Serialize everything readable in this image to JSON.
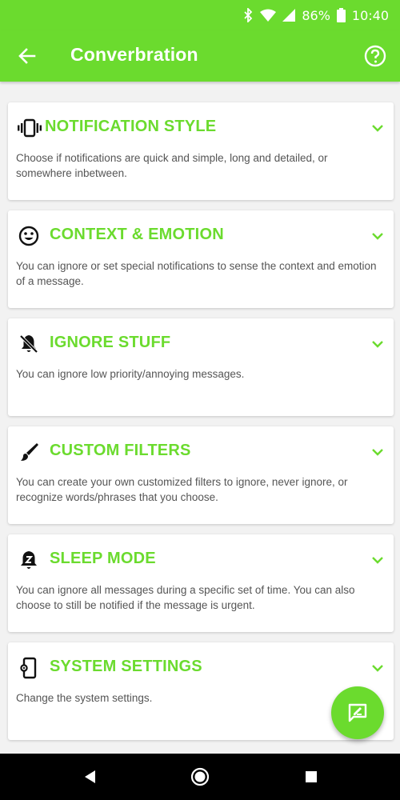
{
  "status_bar": {
    "battery": "86%",
    "time": "10:40",
    "icons": [
      "bluetooth-icon",
      "wifi-icon",
      "signal-icon",
      "battery-icon"
    ]
  },
  "app_bar": {
    "title": "Converbration",
    "back_icon": "arrow-left-icon",
    "help_icon": "help-circle-icon"
  },
  "colors": {
    "accent": "#6bdb2e",
    "text_secondary": "#555555",
    "background": "#f2f2f2",
    "nav_bar": "#000000"
  },
  "cards": [
    {
      "icon": "vibration-icon",
      "title": "NOTIFICATION STYLE",
      "description": "Choose if notifications are quick and simple, long and detailed, or somewhere inbetween."
    },
    {
      "icon": "smiley-icon",
      "title": "CONTEXT & EMOTION",
      "description": "You can ignore or set special notifications to sense the context and emotion of a message."
    },
    {
      "icon": "bell-off-icon",
      "title": "IGNORE STUFF",
      "description": "You can ignore low priority/annoying messages."
    },
    {
      "icon": "brush-icon",
      "title": "CUSTOM FILTERS",
      "description": "You can create your own customized filters to ignore, never ignore, or recognize words/phrases that you choose."
    },
    {
      "icon": "bell-sleep-icon",
      "title": "SLEEP MODE",
      "description": "You can ignore all messages during a specific set of time. You can also choose to still be notified if the message is urgent."
    },
    {
      "icon": "phone-settings-icon",
      "title": "SYSTEM SETTINGS",
      "description": "Change the system settings."
    }
  ],
  "fab": {
    "icon": "feedback-icon"
  },
  "nav_bar": {
    "buttons": [
      "back-triangle-icon",
      "home-circle-icon",
      "recents-square-icon"
    ]
  }
}
